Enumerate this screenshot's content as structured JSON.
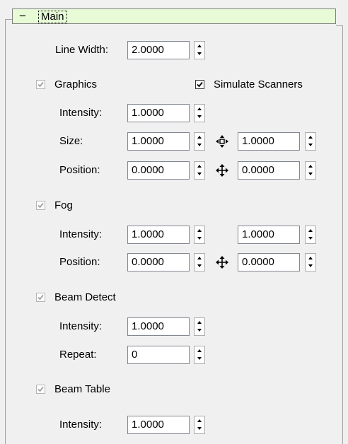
{
  "group": {
    "title": "Main",
    "toggle": "−"
  },
  "line_width": {
    "label": "Line Width:",
    "value": "2.0000"
  },
  "graphics": {
    "label": "Graphics",
    "checked": true,
    "simulate_scanners": {
      "label": "Simulate Scanners",
      "checked": true
    },
    "intensity": {
      "label": "Intensity:",
      "value": "1.0000"
    },
    "size": {
      "label": "Size:",
      "value1": "1.0000",
      "value2": "1.0000",
      "icon": "resize-icon"
    },
    "position": {
      "label": "Position:",
      "value1": "0.0000",
      "value2": "0.0000",
      "icon": "move-arrows-icon"
    }
  },
  "fog": {
    "label": "Fog",
    "checked": true,
    "intensity": {
      "label": "Intensity:",
      "value1": "1.0000",
      "value2": "1.0000"
    },
    "position": {
      "label": "Position:",
      "value1": "0.0000",
      "value2": "0.0000",
      "icon": "move-arrows-icon"
    }
  },
  "beam_detect": {
    "label": "Beam Detect",
    "checked": true,
    "intensity": {
      "label": "Intensity:",
      "value": "1.0000"
    },
    "repeat": {
      "label": "Repeat:",
      "value": "0"
    }
  },
  "beam_table": {
    "label": "Beam Table",
    "checked": true,
    "intensity": {
      "label": "Intensity:",
      "value": "1.0000"
    }
  },
  "colors": {
    "panel_bg": "#f0f0f0",
    "header_bg": "#e6fbd6",
    "disabled_check": "#a0a0a0"
  }
}
